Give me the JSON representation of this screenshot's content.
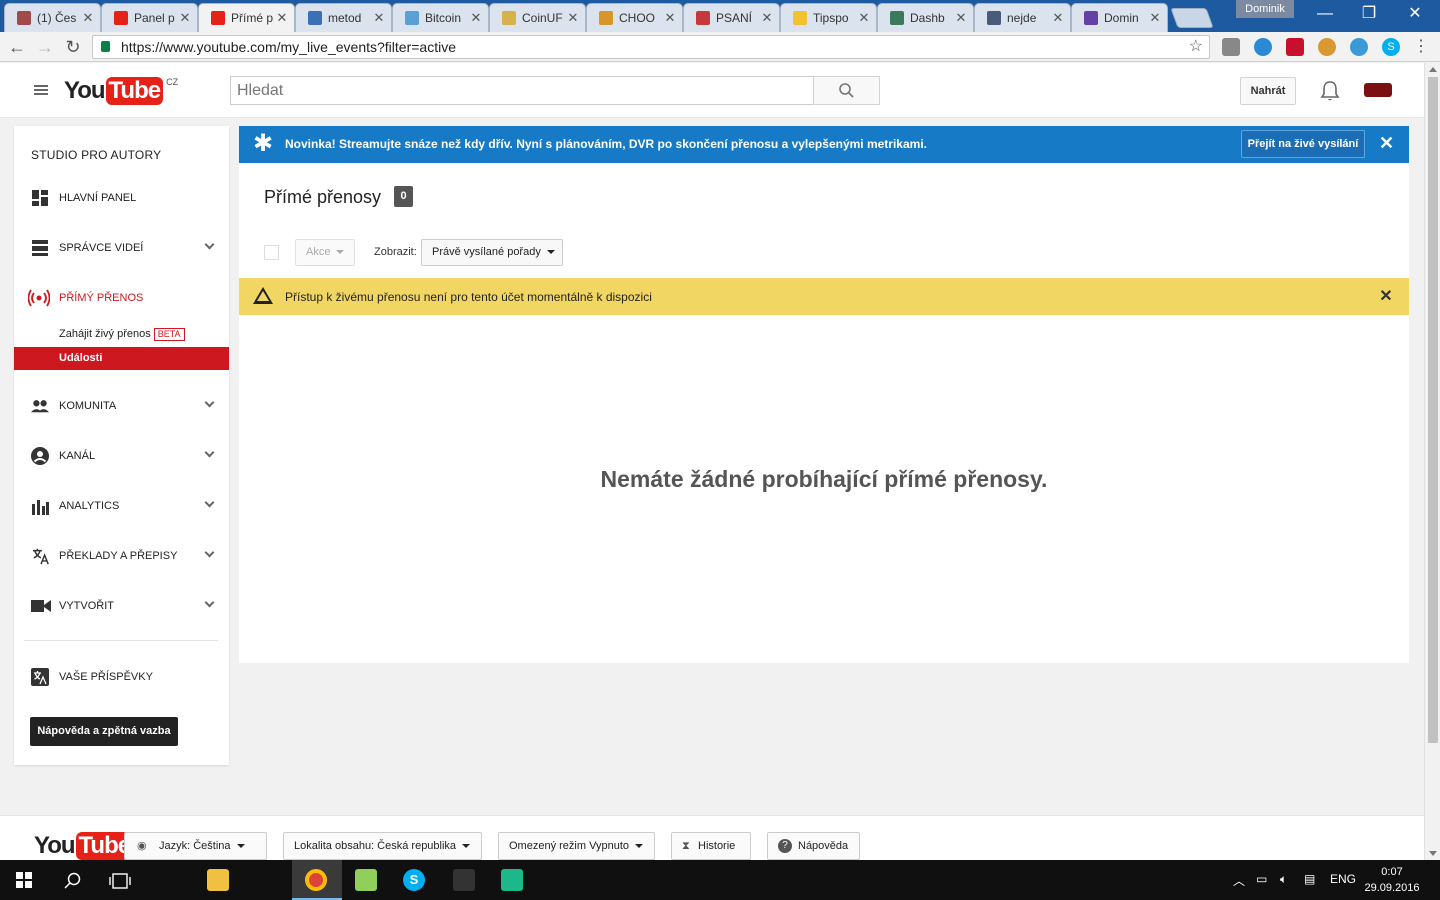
{
  "browser": {
    "tabs": [
      {
        "label": "(1) Čes",
        "color": "#a14a4a",
        "active": false
      },
      {
        "label": "Panel p",
        "color": "#e62117",
        "active": false
      },
      {
        "label": "Přímé p",
        "color": "#e62117",
        "active": true
      },
      {
        "label": "metod",
        "color": "#3b6fb6",
        "active": false
      },
      {
        "label": "Bitcoin",
        "color": "#5aa0d6",
        "active": false
      },
      {
        "label": "CoinUF",
        "color": "#d6b24a",
        "active": false
      },
      {
        "label": "CHOO",
        "color": "#d6962a",
        "active": false
      },
      {
        "label": "PSANÍ",
        "color": "#c43a3a",
        "active": false
      },
      {
        "label": "Tipspo",
        "color": "#f2c230",
        "active": false
      },
      {
        "label": "Dashb",
        "color": "#3a7a5a",
        "active": false
      },
      {
        "label": "nejde",
        "color": "#4a5a7a",
        "active": false
      },
      {
        "label": "Domin",
        "color": "#6441a4",
        "active": false
      }
    ],
    "tab_close": "✕",
    "profile_name": "Dominik",
    "url": "https://www.youtube.com/my_live_events?filter=active",
    "window_controls": {
      "min": "—",
      "max": "❐",
      "close": "✕"
    }
  },
  "youtube": {
    "logo_you": "You",
    "logo_tube": "Tube",
    "logo_country": "CZ",
    "search_placeholder": "Hledat",
    "upload_label": "Nahrát"
  },
  "sidebar": {
    "title": "STUDIO PRO AUTORY",
    "items": [
      {
        "label": "HLAVNÍ PANEL",
        "icon": "dashboard-icon",
        "expandable": false
      },
      {
        "label": "SPRÁVCE VIDEÍ",
        "icon": "video-manager-icon",
        "expandable": true
      },
      {
        "label": "PŘÍMÝ PŘENOS",
        "icon": "live-icon",
        "expandable": false,
        "active": true
      },
      {
        "label": "KOMUNITA",
        "icon": "community-icon",
        "expandable": true
      },
      {
        "label": "KANÁL",
        "icon": "channel-icon",
        "expandable": true
      },
      {
        "label": "ANALYTICS",
        "icon": "analytics-icon",
        "expandable": true
      },
      {
        "label": "PŘEKLADY A PŘEPISY",
        "icon": "translate-icon",
        "expandable": true
      },
      {
        "label": "VYTVOŘIT",
        "icon": "create-icon",
        "expandable": true
      }
    ],
    "live_sub": {
      "start_label": "Zahájit živý přenos",
      "beta_label": "BETA",
      "events_label": "Události"
    },
    "contributions_label": "VAŠE PŘÍSPĚVKY",
    "help_label": "Nápověda a zpětná vazba"
  },
  "banner": {
    "text": "Novinka! Streamujte snáze než kdy dřív. Nyní s plánováním, DVR po skončení přenosu a vylepšenými metrikami.",
    "button_label": "Přejít na živé vysílání",
    "close": "✕"
  },
  "main": {
    "title": "Přímé přenosy",
    "count": "0",
    "actions_label": "Akce",
    "show_label": "Zobrazit:",
    "filter_value": "Právě vysílané pořady",
    "warning_text": "Přístup k živému přenosu není pro tento účet momentálně k dispozici",
    "warning_close": "✕",
    "empty_message": "Nemáte žádné probíhající přímé přenosy."
  },
  "footer": {
    "language_label": "Jazyk: Čeština",
    "location_label": "Lokalita obsahu: Česká republika",
    "restricted_label": "Omezený režim Vypnuto",
    "history_label": "Historie",
    "help_label": "Nápověda"
  },
  "taskbar": {
    "language": "ENG",
    "time": "0:07",
    "date": "29.09.2016"
  }
}
